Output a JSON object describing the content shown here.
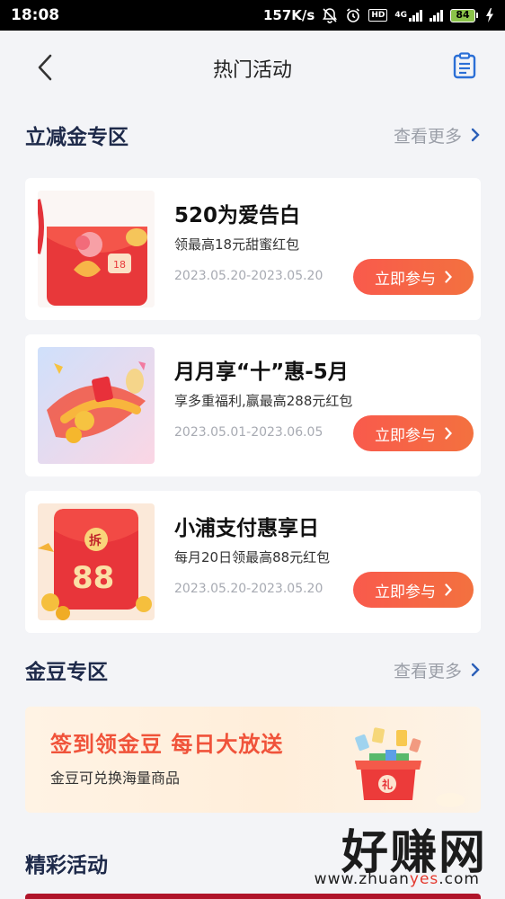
{
  "status_bar": {
    "time": "18:08",
    "net_speed": "157K/s",
    "hd_badge": "HD",
    "network_type": "4G",
    "battery_level": "84"
  },
  "nav": {
    "title": "热门活动"
  },
  "discount_section": {
    "title": "立减金专区",
    "more_label": "查看更多"
  },
  "activities": [
    {
      "title": "520为爱告白",
      "desc": "领最高18元甜蜜红包",
      "date": "2023.05.20-2023.05.20",
      "button": "立即参与"
    },
    {
      "title": "月月享“十”惠-5月",
      "desc": "享多重福利,赢最高288元红包",
      "date": "2023.05.01-2023.06.05",
      "button": "立即参与"
    },
    {
      "title": "小浦支付惠享日",
      "desc": "每月20日领最高88元红包",
      "date": "2023.05.20-2023.05.20",
      "button": "立即参与"
    }
  ],
  "bean_section": {
    "title": "金豆专区",
    "more_label": "查看更多",
    "banner_title": "签到领金豆  每日大放送",
    "banner_sub": "金豆可兑换海量商品",
    "gift_label": "礼"
  },
  "featured_section": {
    "title": "精彩活动"
  },
  "thumb_text": {
    "card3_badge": "拆",
    "card3_number": "88"
  },
  "watermark": {
    "big": "好赚网",
    "small_a": "www.zhuan",
    "small_b": "yes",
    "small_c": ".com"
  },
  "colors": {
    "accent": "#f95a4c",
    "section_title": "#1e2a4a",
    "nav_icon": "#2b6fd6"
  }
}
